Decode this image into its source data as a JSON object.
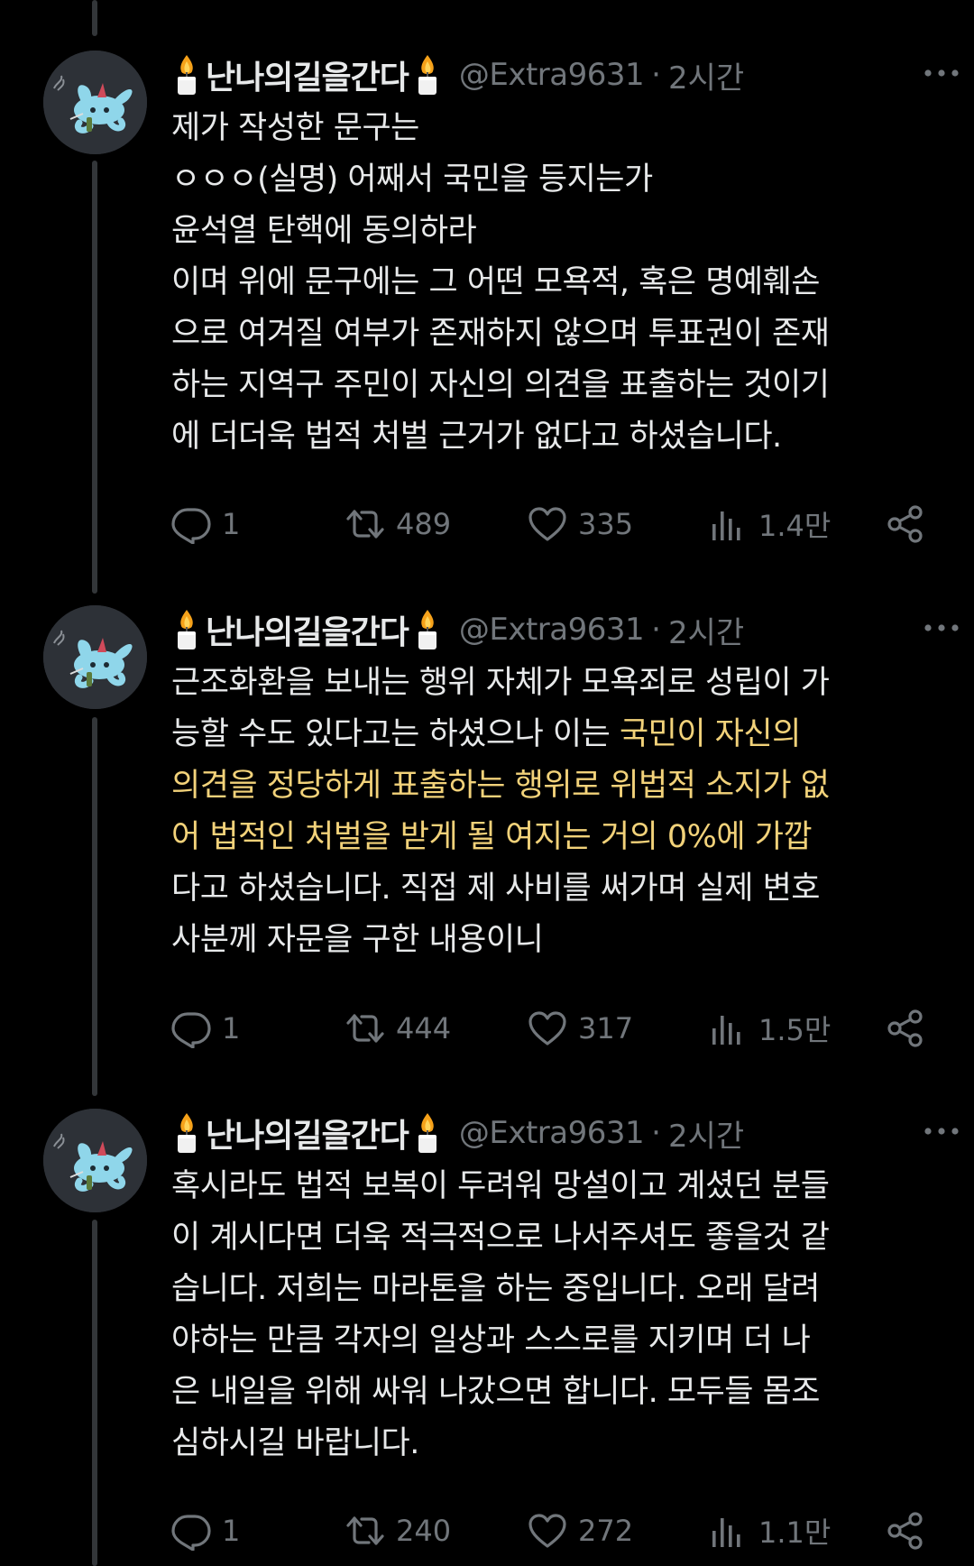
{
  "colors": {
    "background": "#000000",
    "text": "#e7e9ea",
    "muted": "#71767b",
    "highlight": "#f2d27a",
    "thread_line": "#333639"
  },
  "tweets": [
    {
      "display_name": "난나의길을간다",
      "name_icons": [
        "candle-icon",
        "candle-icon"
      ],
      "handle": "@Extra9631",
      "separator": "·",
      "time": "2시간",
      "lines": [
        "제가 작성한 문구는",
        "ㅇㅇㅇ(실명) 어째서 국민을 등지는가",
        "윤석열 탄핵에 동의하라",
        "이며 위에 문구에는 그 어떤 모욕적, 혹은 명예훼손",
        "으로 여겨질 여부가 존재하지 않으며 투표권이 존재",
        "하는 지역구 주민이 자신의 의견을 표출하는 것이기",
        "에 더더욱 법적 처벌 근거가 없다고 하셨습니다."
      ],
      "replies": "1",
      "retweets": "489",
      "likes": "335",
      "views": "1.4만"
    },
    {
      "display_name": "난나의길을간다",
      "name_icons": [
        "candle-icon",
        "candle-icon"
      ],
      "handle": "@Extra9631",
      "separator": "·",
      "time": "2시간",
      "line1": "근조화환을 보내는 행위 자체가 모욕죄로 성립이 가",
      "line2_plain": "능할 수도 있다고는 하셨으나 이는 ",
      "line2_highlight": "국민이 자신의",
      "line3_highlight": "의견을 정당하게 표출하는 행위로 위법적 소지가 없",
      "line4_highlight": "어 법적인 처벌을 받게 될 여지는 거의 0%에 가깝",
      "line5": "다고 하셨습니다. 직접 제 사비를 써가며 실제 변호",
      "line6": "사분께 자문을 구한 내용이니",
      "replies": "1",
      "retweets": "444",
      "likes": "317",
      "views": "1.5만"
    },
    {
      "display_name": "난나의길을간다",
      "name_icons": [
        "candle-icon",
        "candle-icon"
      ],
      "handle": "@Extra9631",
      "separator": "·",
      "time": "2시간",
      "lines": [
        "혹시라도 법적 보복이 두려워 망설이고 계셨던 분들",
        "이 계시다면 더욱 적극적으로 나서주셔도 좋을것 같",
        "습니다. 저희는 마라톤을 하는 중입니다. 오래 달려",
        "야하는 만큼 각자의 일상과 스스로를 지키며 더 나",
        "은 내일을 위해 싸워 나갔으면 합니다. 모두들 몸조",
        "심하시길 바랍니다."
      ],
      "replies": "1",
      "retweets": "240",
      "likes": "272",
      "views": "1.1만"
    }
  ]
}
